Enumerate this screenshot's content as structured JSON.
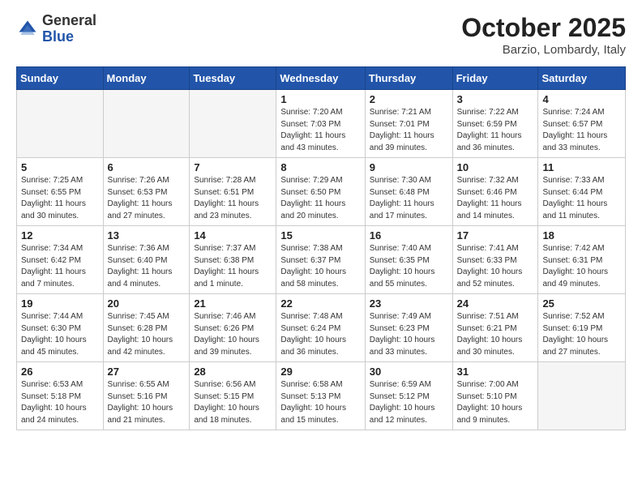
{
  "header": {
    "logo_general": "General",
    "logo_blue": "Blue",
    "month": "October 2025",
    "location": "Barzio, Lombardy, Italy"
  },
  "days_of_week": [
    "Sunday",
    "Monday",
    "Tuesday",
    "Wednesday",
    "Thursday",
    "Friday",
    "Saturday"
  ],
  "weeks": [
    [
      {
        "num": "",
        "info": ""
      },
      {
        "num": "",
        "info": ""
      },
      {
        "num": "",
        "info": ""
      },
      {
        "num": "1",
        "info": "Sunrise: 7:20 AM\nSunset: 7:03 PM\nDaylight: 11 hours\nand 43 minutes."
      },
      {
        "num": "2",
        "info": "Sunrise: 7:21 AM\nSunset: 7:01 PM\nDaylight: 11 hours\nand 39 minutes."
      },
      {
        "num": "3",
        "info": "Sunrise: 7:22 AM\nSunset: 6:59 PM\nDaylight: 11 hours\nand 36 minutes."
      },
      {
        "num": "4",
        "info": "Sunrise: 7:24 AM\nSunset: 6:57 PM\nDaylight: 11 hours\nand 33 minutes."
      }
    ],
    [
      {
        "num": "5",
        "info": "Sunrise: 7:25 AM\nSunset: 6:55 PM\nDaylight: 11 hours\nand 30 minutes."
      },
      {
        "num": "6",
        "info": "Sunrise: 7:26 AM\nSunset: 6:53 PM\nDaylight: 11 hours\nand 27 minutes."
      },
      {
        "num": "7",
        "info": "Sunrise: 7:28 AM\nSunset: 6:51 PM\nDaylight: 11 hours\nand 23 minutes."
      },
      {
        "num": "8",
        "info": "Sunrise: 7:29 AM\nSunset: 6:50 PM\nDaylight: 11 hours\nand 20 minutes."
      },
      {
        "num": "9",
        "info": "Sunrise: 7:30 AM\nSunset: 6:48 PM\nDaylight: 11 hours\nand 17 minutes."
      },
      {
        "num": "10",
        "info": "Sunrise: 7:32 AM\nSunset: 6:46 PM\nDaylight: 11 hours\nand 14 minutes."
      },
      {
        "num": "11",
        "info": "Sunrise: 7:33 AM\nSunset: 6:44 PM\nDaylight: 11 hours\nand 11 minutes."
      }
    ],
    [
      {
        "num": "12",
        "info": "Sunrise: 7:34 AM\nSunset: 6:42 PM\nDaylight: 11 hours\nand 7 minutes."
      },
      {
        "num": "13",
        "info": "Sunrise: 7:36 AM\nSunset: 6:40 PM\nDaylight: 11 hours\nand 4 minutes."
      },
      {
        "num": "14",
        "info": "Sunrise: 7:37 AM\nSunset: 6:38 PM\nDaylight: 11 hours\nand 1 minute."
      },
      {
        "num": "15",
        "info": "Sunrise: 7:38 AM\nSunset: 6:37 PM\nDaylight: 10 hours\nand 58 minutes."
      },
      {
        "num": "16",
        "info": "Sunrise: 7:40 AM\nSunset: 6:35 PM\nDaylight: 10 hours\nand 55 minutes."
      },
      {
        "num": "17",
        "info": "Sunrise: 7:41 AM\nSunset: 6:33 PM\nDaylight: 10 hours\nand 52 minutes."
      },
      {
        "num": "18",
        "info": "Sunrise: 7:42 AM\nSunset: 6:31 PM\nDaylight: 10 hours\nand 49 minutes."
      }
    ],
    [
      {
        "num": "19",
        "info": "Sunrise: 7:44 AM\nSunset: 6:30 PM\nDaylight: 10 hours\nand 45 minutes."
      },
      {
        "num": "20",
        "info": "Sunrise: 7:45 AM\nSunset: 6:28 PM\nDaylight: 10 hours\nand 42 minutes."
      },
      {
        "num": "21",
        "info": "Sunrise: 7:46 AM\nSunset: 6:26 PM\nDaylight: 10 hours\nand 39 minutes."
      },
      {
        "num": "22",
        "info": "Sunrise: 7:48 AM\nSunset: 6:24 PM\nDaylight: 10 hours\nand 36 minutes."
      },
      {
        "num": "23",
        "info": "Sunrise: 7:49 AM\nSunset: 6:23 PM\nDaylight: 10 hours\nand 33 minutes."
      },
      {
        "num": "24",
        "info": "Sunrise: 7:51 AM\nSunset: 6:21 PM\nDaylight: 10 hours\nand 30 minutes."
      },
      {
        "num": "25",
        "info": "Sunrise: 7:52 AM\nSunset: 6:19 PM\nDaylight: 10 hours\nand 27 minutes."
      }
    ],
    [
      {
        "num": "26",
        "info": "Sunrise: 6:53 AM\nSunset: 5:18 PM\nDaylight: 10 hours\nand 24 minutes."
      },
      {
        "num": "27",
        "info": "Sunrise: 6:55 AM\nSunset: 5:16 PM\nDaylight: 10 hours\nand 21 minutes."
      },
      {
        "num": "28",
        "info": "Sunrise: 6:56 AM\nSunset: 5:15 PM\nDaylight: 10 hours\nand 18 minutes."
      },
      {
        "num": "29",
        "info": "Sunrise: 6:58 AM\nSunset: 5:13 PM\nDaylight: 10 hours\nand 15 minutes."
      },
      {
        "num": "30",
        "info": "Sunrise: 6:59 AM\nSunset: 5:12 PM\nDaylight: 10 hours\nand 12 minutes."
      },
      {
        "num": "31",
        "info": "Sunrise: 7:00 AM\nSunset: 5:10 PM\nDaylight: 10 hours\nand 9 minutes."
      },
      {
        "num": "",
        "info": ""
      }
    ]
  ]
}
